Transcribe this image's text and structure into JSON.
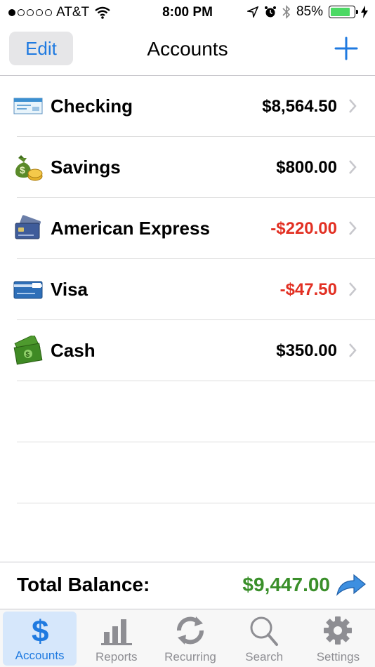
{
  "status_bar": {
    "carrier": "AT&T",
    "time": "8:00 PM",
    "battery_percent": "85%",
    "battery_level": 0.85,
    "signal_bars_filled": 1,
    "signal_bars_total": 5
  },
  "nav": {
    "edit_label": "Edit",
    "title": "Accounts",
    "add_icon": "plus-icon"
  },
  "accounts": [
    {
      "name": "Checking",
      "amount": "$8,564.50",
      "negative": false,
      "icon": "check-icon"
    },
    {
      "name": "Savings",
      "amount": "$800.00",
      "negative": false,
      "icon": "money-bag-icon"
    },
    {
      "name": "American Express",
      "amount": "-$220.00",
      "negative": true,
      "icon": "credit-card-icon"
    },
    {
      "name": "Visa",
      "amount": "-$47.50",
      "negative": true,
      "icon": "visa-card-icon"
    },
    {
      "name": "Cash",
      "amount": "$350.00",
      "negative": false,
      "icon": "cash-icon"
    }
  ],
  "total": {
    "label": "Total Balance:",
    "value": "$9,447.00"
  },
  "tabs": [
    {
      "label": "Accounts",
      "icon": "dollar-icon",
      "active": true
    },
    {
      "label": "Reports",
      "icon": "bar-chart-icon",
      "active": false
    },
    {
      "label": "Recurring",
      "icon": "recurring-icon",
      "active": false
    },
    {
      "label": "Search",
      "icon": "search-icon",
      "active": false
    },
    {
      "label": "Settings",
      "icon": "gear-icon",
      "active": false
    }
  ],
  "colors": {
    "accent": "#1f7ae0",
    "negative": "#e23023",
    "positive_total": "#3a8f2a"
  }
}
